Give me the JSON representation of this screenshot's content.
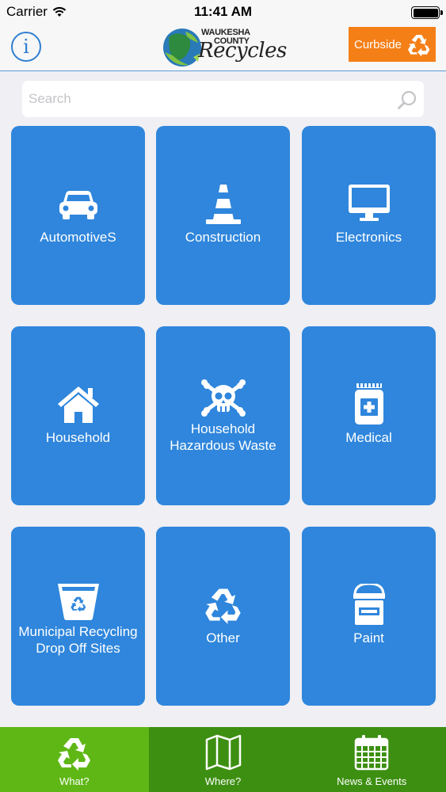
{
  "status_bar": {
    "carrier": "Carrier",
    "time": "11:41 AM"
  },
  "nav": {
    "info_label": "i",
    "logo_line1": "WAUKESHA",
    "logo_line2": "COUNTY",
    "logo_line3": "Recycles",
    "curbside_label": "Curbside"
  },
  "search": {
    "placeholder": "Search"
  },
  "tiles": [
    {
      "label": "AutomotiveS",
      "icon": "car-icon"
    },
    {
      "label": "Construction",
      "icon": "traffic-cone-icon"
    },
    {
      "label": "Electronics",
      "icon": "monitor-icon"
    },
    {
      "label": "Household",
      "icon": "house-icon"
    },
    {
      "label": "Household Hazardous Waste",
      "line1": "Household",
      "line2": "Hazardous Waste",
      "icon": "skull-crossbones-icon"
    },
    {
      "label": "Medical",
      "icon": "medicine-bottle-icon"
    },
    {
      "label": "Municipal Recycling Drop Off Sites",
      "line1": "Municipal Recycling",
      "line2": "Drop Off Sites",
      "icon": "recycle-bin-icon"
    },
    {
      "label": "Other",
      "icon": "recycle-icon"
    },
    {
      "label": "Paint",
      "icon": "paint-can-icon"
    }
  ],
  "tab_bar": {
    "tabs": [
      {
        "label": "What?",
        "icon": "recycle-icon",
        "active": true
      },
      {
        "label": "Where?",
        "icon": "map-icon",
        "active": false
      },
      {
        "label": "News & Events",
        "icon": "calendar-icon",
        "active": false
      }
    ]
  },
  "colors": {
    "tile": "#2f86dc",
    "curbside": "#f57f17",
    "tab_bar": "#3d8f12",
    "tab_active": "#5fb715",
    "info": "#2f7fd1"
  }
}
